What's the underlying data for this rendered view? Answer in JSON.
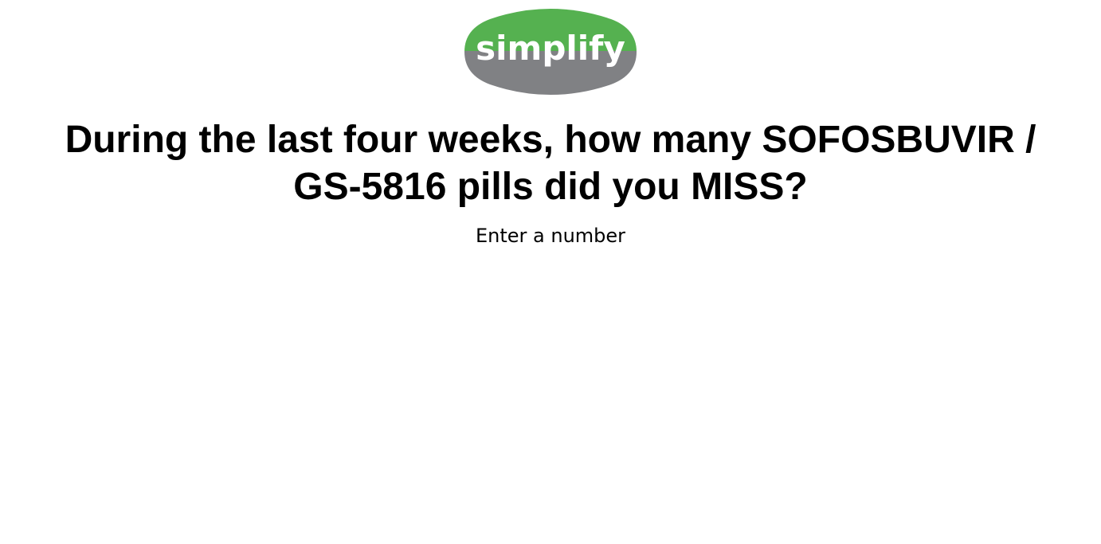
{
  "logo": {
    "text": "simplify",
    "top_color": "#55b150",
    "bottom_color": "#808184",
    "text_color": "#ffffff"
  },
  "question": {
    "line1": "During the last four weeks, how many SOFOSBUVIR /",
    "line2": "GS-5816 pills did you MISS?"
  },
  "answer": {
    "hint": "Enter a number"
  }
}
